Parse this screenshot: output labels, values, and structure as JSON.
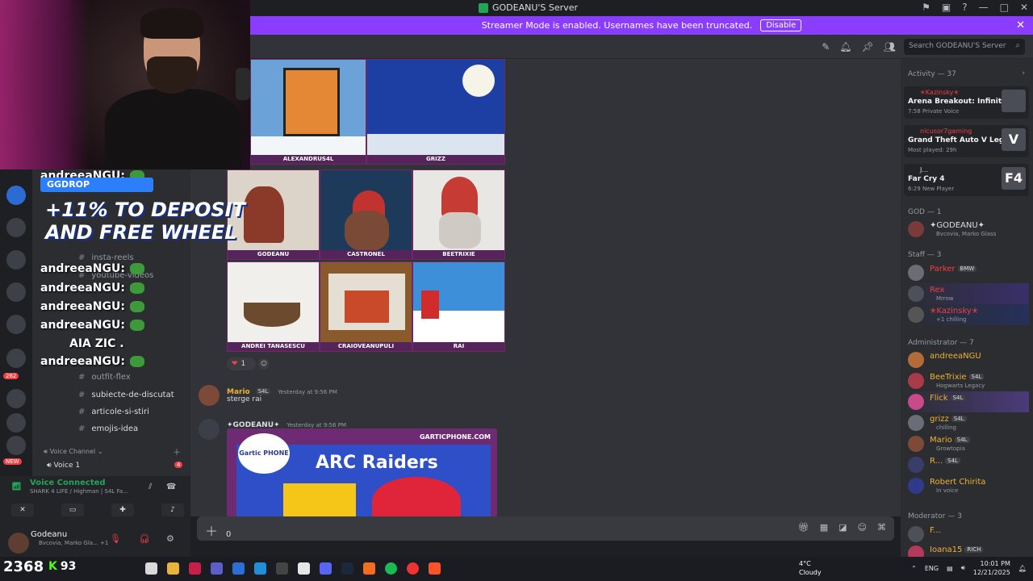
{
  "window": {
    "title": "GODEANU'S Server"
  },
  "banner": {
    "text": "Streamer Mode is enabled. Usernames have been truncated.",
    "button": "Disable"
  },
  "header": {
    "search_placeholder": "Search GODEANU'S Server"
  },
  "art_tiles": [
    {
      "caption": "ALEXANDRUS4L",
      "bg": "#e48836"
    },
    {
      "caption": "GRIZZ",
      "bg": "#1d3fa4"
    },
    {
      "caption": "GODEANU",
      "bg": "#dcd4c8"
    },
    {
      "caption": "CASTRONEL",
      "bg": "#1e3a5a"
    },
    {
      "caption": "BEETRIXIE",
      "bg": "#e9e7e3"
    },
    {
      "caption": "ANDREI TANASESCU",
      "bg": "#f1efec"
    },
    {
      "caption": "CRAIOVEANUPULI",
      "bg": "#8a5a2c"
    },
    {
      "caption": "RAI",
      "bg": "#3e8fd9"
    }
  ],
  "reaction": {
    "count": "1"
  },
  "messages": [
    {
      "author": "Mario",
      "badge": "S4L",
      "time": "Yesterday at 9:56 PM",
      "text": "sterge rai",
      "color": "#f0b232"
    },
    {
      "author": "✦GODEANU✦",
      "time": "Yesterday at 9:56 PM",
      "color": "#dbdee1"
    }
  ],
  "gartic_card": {
    "site": "GARTICPHONE.COM",
    "logo": "Gartic PHONE",
    "art_text": "ARC Raiders"
  },
  "composer": {
    "value": "0"
  },
  "sidebar": {
    "promo": {
      "brand": "GGDROP",
      "line1": "+11% TO DEPOSIT",
      "line2": "AND FREE WHEEL"
    },
    "chat_overlay": [
      {
        "text": "andreeaNGU:"
      },
      {
        "text": "andreeaNGU:"
      },
      {
        "text": "andreeaNGU:"
      },
      {
        "text": "andreeaNGU:"
      },
      {
        "text": "andreeaNGU:"
      },
      {
        "text": "AIA ZIC ."
      },
      {
        "text": "andreeaNGU:"
      }
    ],
    "channels": [
      {
        "name": "insta-reels"
      },
      {
        "name": "youtube-videos"
      },
      {
        "name": "outfit-flex"
      },
      {
        "name": "subiecte-de-discutat"
      },
      {
        "name": "articole-si-stiri"
      },
      {
        "name": "emojis-idea"
      }
    ],
    "voice_category": "Voice Channel",
    "voice_channel": "Voice 1",
    "voice_badge": "4",
    "new_badge": "NEW",
    "server_badge": "262"
  },
  "voice_panel": {
    "status": "Voice Connected",
    "channel": "SHARK 4 LIFE / Highman | S4L Fa...",
    "user": "Godeanu",
    "user_status": "Bvcovia, Marko Gla... +1"
  },
  "members": {
    "activity_header": "Activity — 37",
    "activities": [
      {
        "user": "✭Kazinsky✭",
        "game": "Arena Breakout: Infinite",
        "meta": "7:58  Private Voice",
        "icon": ""
      },
      {
        "user": "nicusor7gaming",
        "game": "Grand Theft Auto V Legacy",
        "meta": "Most played: 29h",
        "icon": "V"
      },
      {
        "user": "J...",
        "game": "Far Cry 4",
        "meta": "6:29  New Player",
        "icon": "F4"
      }
    ],
    "groups": [
      {
        "label": "GOD — 1",
        "items": [
          {
            "name": "✦GODEANU✦",
            "status": "Bvcovia, Marko Glass",
            "color": "#dbdee1"
          }
        ]
      },
      {
        "label": "Staff — 3",
        "items": [
          {
            "name": "Parker",
            "tag": "BMW",
            "status": "",
            "color": "#f23f43"
          },
          {
            "name": "Rex",
            "status": "Mrrow",
            "color": "#f23f43"
          },
          {
            "name": "✭Kazinsky✭",
            "status": "+1  chilling",
            "color": "#f23f43"
          }
        ]
      },
      {
        "label": "Administrator — 7",
        "items": [
          {
            "name": "andreeaNGU",
            "status": "",
            "color": "#f0b232"
          },
          {
            "name": "BeeTrixie",
            "tag": "S4L",
            "status": "Hogwarts Legacy",
            "color": "#f0b232"
          },
          {
            "name": "Flick",
            "tag": "S4L",
            "status": "",
            "color": "#f0b232"
          },
          {
            "name": "grizz",
            "tag": "S4L",
            "status": "chilling",
            "color": "#f0b232"
          },
          {
            "name": "Mario",
            "tag": "S4L",
            "status": "Growtopia",
            "color": "#f0b232"
          },
          {
            "name": "R...",
            "tag": "S4L",
            "status": "",
            "color": "#f0b232"
          },
          {
            "name": "Robert Chirita",
            "status": "In voice",
            "color": "#f0b232"
          }
        ]
      },
      {
        "label": "Moderator — 3",
        "items": [
          {
            "name": "F...",
            "status": "",
            "color": "#f0b232"
          },
          {
            "name": "Ioana15",
            "tag": "RICH",
            "status": "",
            "color": "#f0b232"
          }
        ]
      }
    ]
  },
  "taskbar": {
    "score": "2368",
    "kick_count": "93",
    "weather_temp": "4°C",
    "weather_text": "Cloudy",
    "lang": "ENG",
    "time": "10:01 PM",
    "date": "12/21/2025"
  }
}
